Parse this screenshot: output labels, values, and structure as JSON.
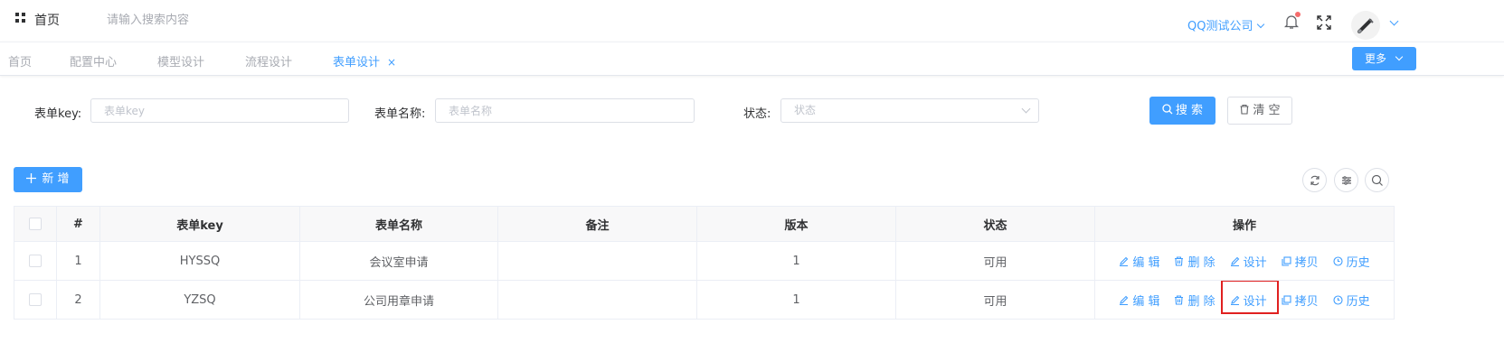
{
  "header": {
    "home_label": "首页",
    "search_placeholder": "请输入搜索内容",
    "company": "QQ测试公司"
  },
  "tabs": [
    {
      "label": "首页"
    },
    {
      "label": "配置中心"
    },
    {
      "label": "模型设计"
    },
    {
      "label": "流程设计"
    },
    {
      "label": "表单设计",
      "active": true,
      "close": "×"
    }
  ],
  "more_button": "更多",
  "filters": {
    "key_label": "表单key:",
    "key_placeholder": "表单key",
    "name_label": "表单名称:",
    "name_placeholder": "表单名称",
    "status_label": "状态:",
    "status_placeholder": "状态",
    "search_button": "搜 索",
    "clear_button": "清 空"
  },
  "add_button": "新 增",
  "table": {
    "headers": [
      "#",
      "表单key",
      "表单名称",
      "备注",
      "版本",
      "状态",
      "操作"
    ],
    "rows": [
      {
        "index": "1",
        "key": "HYSSQ",
        "name": "会议室申请",
        "remark": "",
        "version": "1",
        "status": "可用"
      },
      {
        "index": "2",
        "key": "YZSQ",
        "name": "公司用章申请",
        "remark": "",
        "version": "1",
        "status": "可用"
      }
    ],
    "ops": {
      "edit": "编 辑",
      "delete": "删 除",
      "design": "设计",
      "copy": "拷贝",
      "history": "历史"
    }
  },
  "colors": {
    "primary": "#409eff",
    "highlight": "#e02020",
    "badge": "#f56c6c"
  }
}
